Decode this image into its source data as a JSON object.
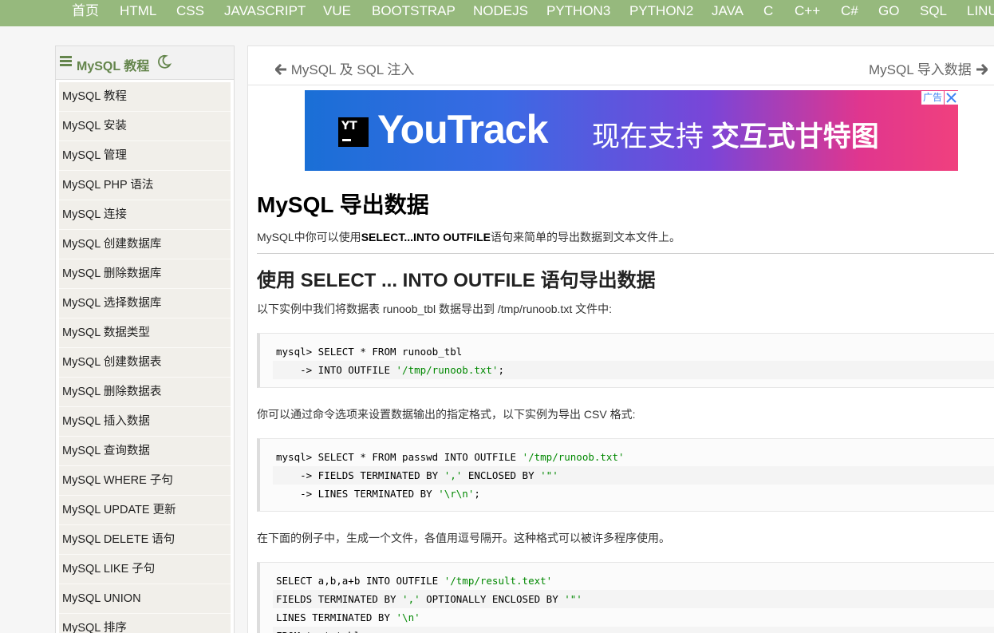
{
  "topnav": {
    "items": [
      "首页",
      "HTML",
      "CSS",
      "JAVASCRIPT",
      "VUE",
      "BOOTSTRAP",
      "NODEJS",
      "PYTHON3",
      "PYTHON2",
      "JAVA",
      "C",
      "C++",
      "C#",
      "GO",
      "SQL",
      "LINU"
    ]
  },
  "sidebar": {
    "title": "MySQL 教程",
    "items": [
      "MySQL 教程",
      "MySQL 安装",
      "MySQL 管理",
      "MySQL PHP 语法",
      "MySQL 连接",
      "MySQL 创建数据库",
      "MySQL 删除数据库",
      "MySQL 选择数据库",
      "MySQL 数据类型",
      "MySQL 创建数据表",
      "MySQL 删除数据表",
      "MySQL 插入数据",
      "MySQL 查询数据",
      "MySQL WHERE 子句",
      "MySQL UPDATE 更新",
      "MySQL DELETE 语句",
      "MySQL LIKE 子句",
      "MySQL UNION",
      "MySQL 排序"
    ]
  },
  "pager": {
    "prev": "MySQL 及 SQL 注入",
    "next": "MySQL 导入数据"
  },
  "ad": {
    "logo_text": "YT",
    "brand": "YouTrack",
    "slogan_plain": "现在支持",
    "slogan_bold": "交互式甘特图",
    "badge": "广告"
  },
  "article": {
    "title": "MySQL 导出数据",
    "intro_before": "MySQL中你可以使用",
    "intro_bold": "SELECT...INTO OUTFILE",
    "intro_after": "语句来简单的导出数据到文本文件上。",
    "section_title": "使用 SELECT ... INTO OUTFILE 语句导出数据",
    "para1": "以下实例中我们将数据表 runoob_tbl 数据导出到 /tmp/runoob.txt 文件中:",
    "para2": "你可以通过命令选项来设置数据输出的指定格式，以下实例为导出 CSV 格式:",
    "para3": "在下面的例子中，生成一个文件，各值用逗号隔开。这种格式可以被许多程序使用。",
    "code1": [
      {
        "plain": "mysql> SELECT * FROM runoob_tbl",
        "str": "",
        "tail": ""
      },
      {
        "plain": "    -> INTO OUTFILE ",
        "str": "'/tmp/runoob.txt'",
        "tail": ";"
      }
    ],
    "code2": [
      {
        "plain": "mysql> SELECT * FROM passwd INTO OUTFILE ",
        "str": "'/tmp/runoob.txt'",
        "tail": ""
      },
      {
        "plain": "    -> FIELDS TERMINATED BY ",
        "str": "','",
        "tail": " ENCLOSED BY ",
        "str2": "'\"'"
      },
      {
        "plain": "    -> LINES TERMINATED BY ",
        "str": "'\\r\\n'",
        "tail": ";"
      }
    ],
    "code3": [
      {
        "plain": "SELECT a,b,a+b INTO OUTFILE ",
        "str": "'/tmp/result.text'",
        "tail": ""
      },
      {
        "plain": "FIELDS TERMINATED BY ",
        "str": "','",
        "tail": " OPTIONALLY ENCLOSED BY ",
        "str2": "'\"'"
      },
      {
        "plain": "LINES TERMINATED BY ",
        "str": "'\\n'",
        "tail": ""
      },
      {
        "plain": "FROM test_table;",
        "str": "",
        "tail": ""
      }
    ]
  },
  "colors": {
    "nav_bg": "#96b97d",
    "accent": "#64854c",
    "code_string": "#008800"
  }
}
